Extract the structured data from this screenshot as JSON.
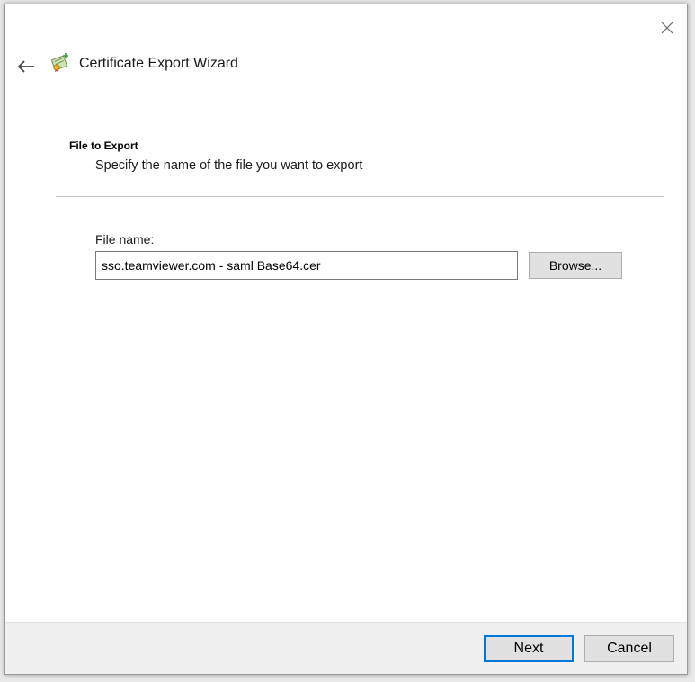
{
  "window": {
    "title": "Certificate Export Wizard"
  },
  "icons": {
    "close": "close-icon",
    "back": "back-arrow-icon",
    "app": "certificate-icon"
  },
  "page": {
    "section_title": "File to Export",
    "section_description": "Specify the name of the file you want to export",
    "file_name_label": "File name:",
    "file_name_value": "sso.teamviewer.com - saml Base64.cer",
    "browse_label": "Browse..."
  },
  "footer": {
    "next_label": "Next",
    "cancel_label": "Cancel"
  },
  "colors": {
    "accent": "#0078d7",
    "footer_bg": "#f0f0f0",
    "button_bg": "#e1e1e1"
  }
}
